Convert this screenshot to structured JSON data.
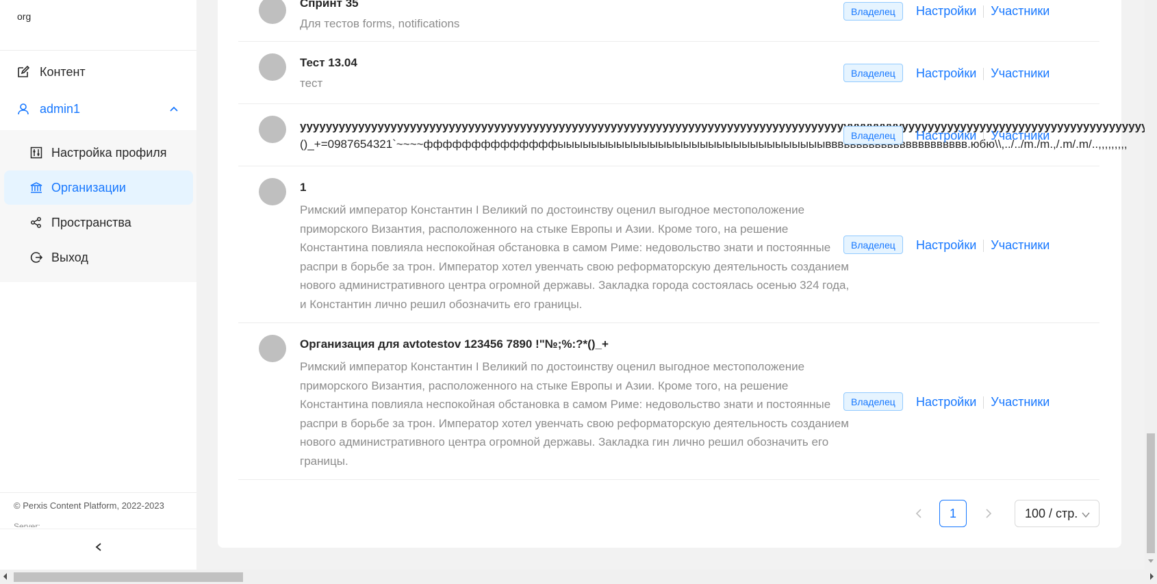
{
  "sidebar": {
    "org": "org",
    "content_label": "Контент",
    "user_label": "admin1",
    "submenu": {
      "profile": "Настройка профиля",
      "orgs": "Организации",
      "spaces": "Пространства",
      "logout": "Выход"
    },
    "copyright": "© Perxis Content Platform,      2022-2023",
    "server": "Server:"
  },
  "rows": [
    {
      "title": "Спринт 35",
      "desc": "Для тестов forms, notifications",
      "badge": "Владелец",
      "settings": "Настройки",
      "members": "Участники"
    },
    {
      "title": "Тест 13.04",
      "desc": "тест",
      "badge": "Владелец",
      "settings": "Настройки",
      "members": "Участники"
    },
    {
      "title": "yyyyyyyyyyyyyyyyyyyyyyyyyyyyyyyyyyyyyyyyyyyyyyyyyyyyyyyyyyyyyyyyyyyyyyyyyyyyyyyyyyyyyyyyyyyyyyyyyyyyyyyyyyyyyyyyyyyyyyyyyyyyyyyyyyyyyyyyyyyyyyyyyyyyyyy",
      "desc": "()_+=0987654321`~~~~ффффффффффффффыыыыыыыыыыыыыыыыыыыыыыыыыыыыыыыыввввввввввввввввввввввв.юбю\\\\,../../m./m.,/.m/.m/..,,,,,,,,,",
      "badge": "Владелец",
      "settings": "Настройки",
      "members": "Участники"
    },
    {
      "title": "1",
      "desc": "Римский император Константин I Великий по достоинству оценил выгодное местоположение приморского Византия, расположенного на стыке Европы и Азии. Кроме того, на решение Константина повлияла неспокойная обстановка в самом Риме: недовольство знати и постоянные распри в борьбе за трон. Император хотел увенчать свою реформаторскую деятельность созданием нового административного центра огромной державы. Закладка города состоялась осенью 324 года, и Константин лично решил обозначить его границы.",
      "badge": "Владелец",
      "settings": "Настройки",
      "members": "Участники"
    },
    {
      "title": "Организация для avtotestov 123456 7890 !\"№;%:?*()_+",
      "desc": "Римский император Константин I Великий по достоинству оценил выгодное местоположение приморского Византия, расположенного на стыке Европы и Азии. Кроме того, на решение Константина повлияла неспокойная обстановка в самом Риме: недовольство знати и постоянные распри в борьбе за трон. Император хотел увенчать свою реформаторскую деятельность созданием нового административного центра огромной державы. Закладка гин лично решил обозначить его границы.",
      "badge": "Владелец",
      "settings": "Настройки",
      "members": "Участники"
    }
  ],
  "pagination": {
    "current": "1",
    "page_size": "100 / стр."
  }
}
